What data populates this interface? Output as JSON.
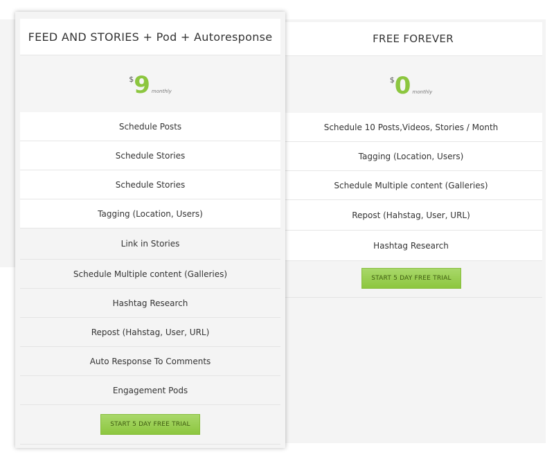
{
  "plans": {
    "feed": {
      "title": "FEED AND STORIES + Pod + Autoresponse",
      "currency": "$",
      "price": "9",
      "period": "monthly",
      "features": [
        "Schedule Posts",
        "Schedule Stories",
        "Schedule Stories",
        "Tagging (Location, Users)",
        "Link in Stories",
        "Schedule Multiple content (Galleries)",
        "Hashtag Research",
        "Repost (Hahstag, User, URL)",
        "Auto Response To Comments",
        "Engagement Pods"
      ],
      "cta": "START 5 DAY FREE TRIAL"
    },
    "free": {
      "title": "FREE FOREVER",
      "currency": "$",
      "price": "0",
      "period": "monthly",
      "features": [
        "Schedule 10 Posts,Videos, Stories / Month",
        "Tagging (Location, Users)",
        "Schedule Multiple content (Galleries)",
        "Repost (Hahstag, User, URL)",
        "Hashtag Research"
      ],
      "cta": "START 5 DAY FREE TRIAL"
    }
  },
  "colors": {
    "accent": "#8cc63f",
    "panel": "#f4f4f4"
  }
}
